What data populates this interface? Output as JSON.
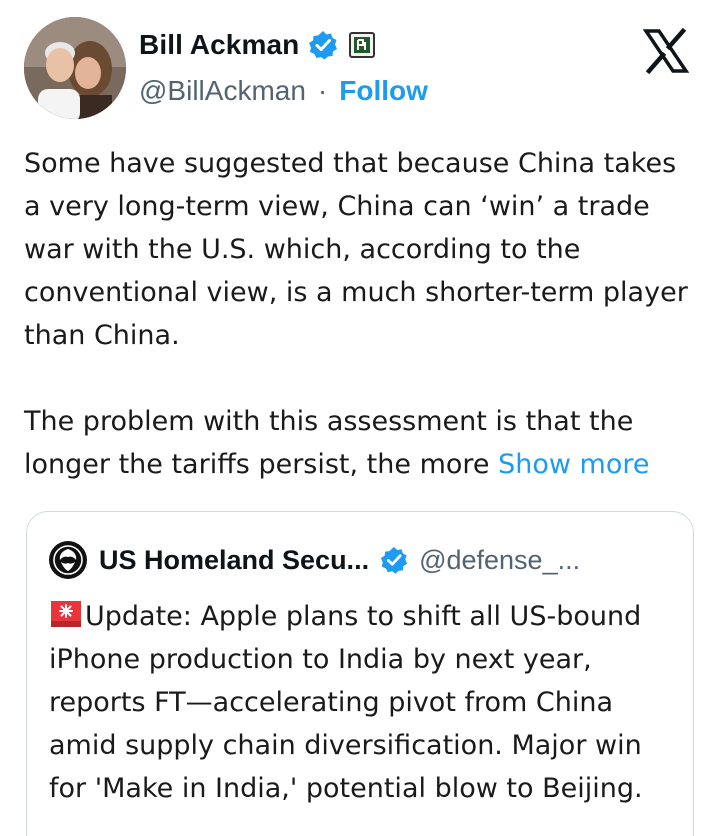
{
  "author": {
    "display_name": "Bill Ackman",
    "handle": "@BillAckman",
    "separator": "·",
    "follow_label": "Follow",
    "avatar_icon": "profile-photo",
    "verified_icon": "verified-badge-icon",
    "affiliate_icon": "affiliate-badge-icon"
  },
  "logo": {
    "icon": "x-logo-icon"
  },
  "tweet": {
    "paragraph1": "Some have suggested that because China takes a very long-term view, China can ‘win’ a trade war with the U.S. which, according to the conventional view, is a much shorter-term player than China.",
    "paragraph2": "The problem with this assessment is that the longer the tariffs persist, the more",
    "show_more": "Show more"
  },
  "quoted_tweet": {
    "display_name": "US Homeland Secu...",
    "handle": "@defense_...",
    "icon": "siren-icon",
    "text": "Update: Apple plans to shift all US-bound iPhone production to India by next year, reports FT—accelerating pivot from China amid supply chain diversification. Major win for 'Make in India,' potential blow to Beijing."
  },
  "colors": {
    "accent": "#1d9bf0",
    "text": "#0f1419",
    "secondary": "#536471",
    "border": "#cfd9de"
  }
}
